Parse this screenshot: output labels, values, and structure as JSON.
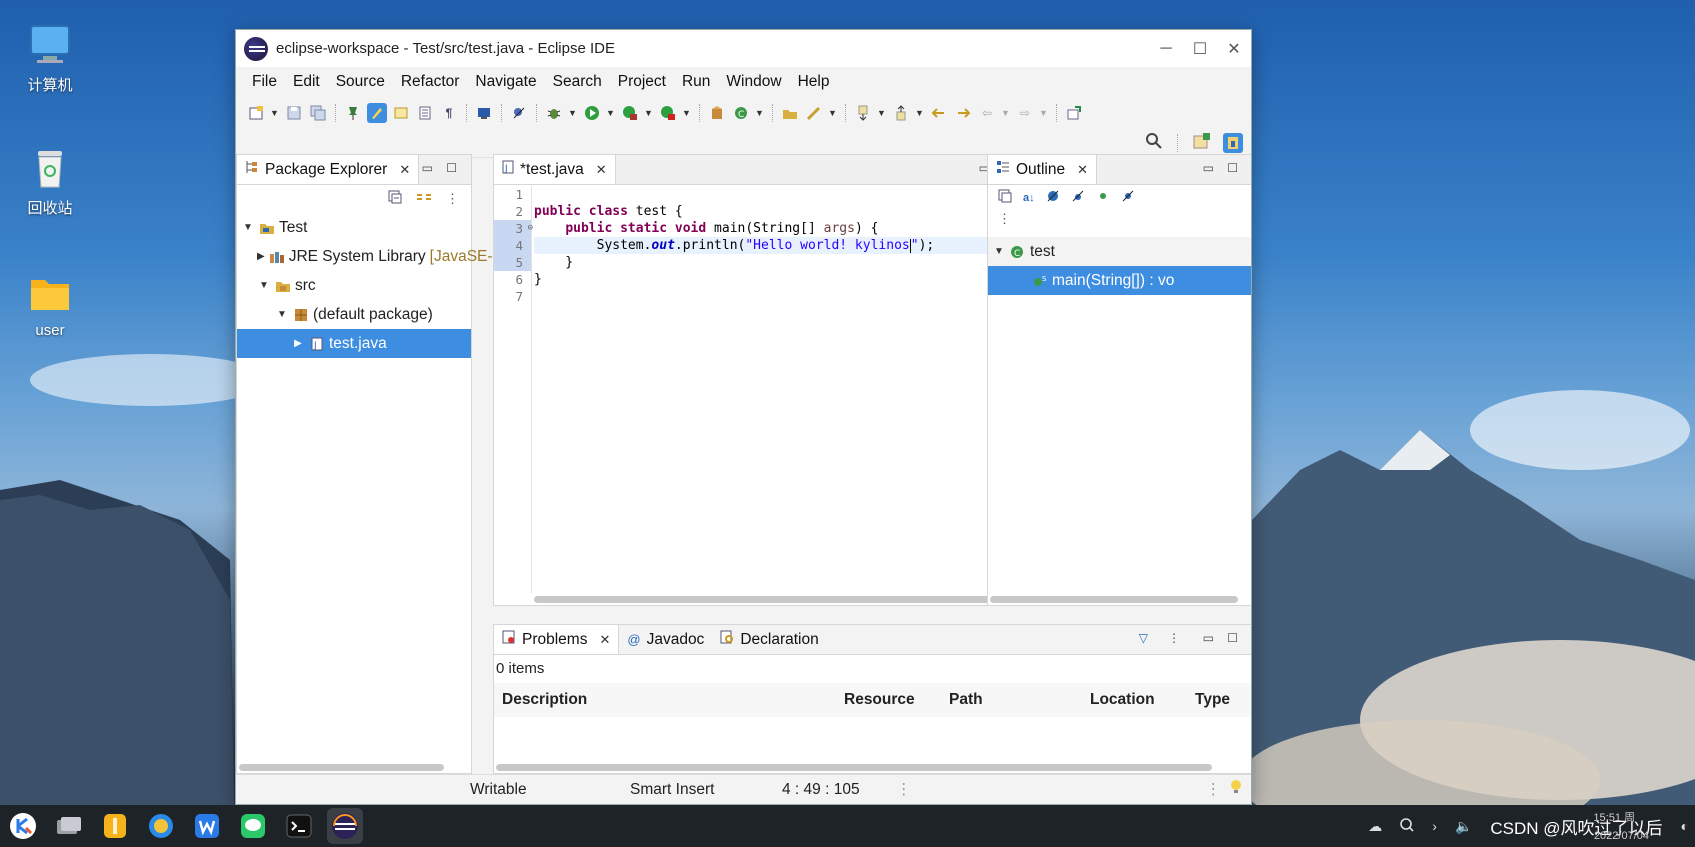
{
  "desktop": {
    "icons": [
      {
        "label": "计算机"
      },
      {
        "label": "回收站"
      },
      {
        "label": "user"
      }
    ]
  },
  "window": {
    "title": "eclipse-workspace - Test/src/test.java - Eclipse IDE",
    "controls": {
      "minimize": "─",
      "maximize": "☐",
      "close": "✕"
    }
  },
  "menu": [
    "File",
    "Edit",
    "Source",
    "Refactor",
    "Navigate",
    "Search",
    "Project",
    "Run",
    "Window",
    "Help"
  ],
  "package_explorer": {
    "tab_label": "Package Explorer",
    "tree": [
      {
        "label": "Test",
        "expanded": "▼"
      },
      {
        "label": "JRE System Library",
        "suffix": "[JavaSE-",
        "expanded": "▶"
      },
      {
        "label": "src",
        "expanded": "▼"
      },
      {
        "label": "(default package)",
        "expanded": "▼"
      },
      {
        "label": "test.java",
        "expanded": "▶"
      }
    ]
  },
  "editor": {
    "tab_label": "*test.java",
    "line_numbers": [
      "1",
      "2",
      "3",
      "4",
      "5",
      "6",
      "7"
    ],
    "fold_marker": "⊖",
    "code": {
      "l2_kw1": "public",
      "l2_kw2": "class",
      "l2_rest": " test {",
      "l3_kw1": "public",
      "l3_kw2": "static",
      "l3_kw3": "void",
      "l3_m": " main(String[] ",
      "l3_param": "args",
      "l3_end": ") {",
      "l4_a": "System.",
      "l4_field": "out",
      "l4_b": ".println(",
      "l4_str": "\"Hello world! kylinos",
      "l4_str_end": "\"",
      "l4_end": ");",
      "l5": "    }",
      "l6": "}"
    }
  },
  "outline": {
    "tab_label": "Outline",
    "class_name": "test",
    "method": "main(String[]) : vo"
  },
  "bottom_panel": {
    "tabs": [
      "Problems",
      "Javadoc",
      "Declaration"
    ],
    "count": "0 items",
    "columns": [
      "Description",
      "Resource",
      "Path",
      "Location",
      "Type"
    ]
  },
  "status": {
    "writable": "Writable",
    "insert_mode": "Smart Insert",
    "position": "4 : 49 : 105"
  },
  "taskbar": {
    "tray_text": "CSDN @风吹过了以后",
    "time": "15:51 周",
    "date": "2022/07/04"
  },
  "colors": {
    "selection": "#3d8de0",
    "keyword": "#7f0055",
    "string": "#2a00ff"
  }
}
